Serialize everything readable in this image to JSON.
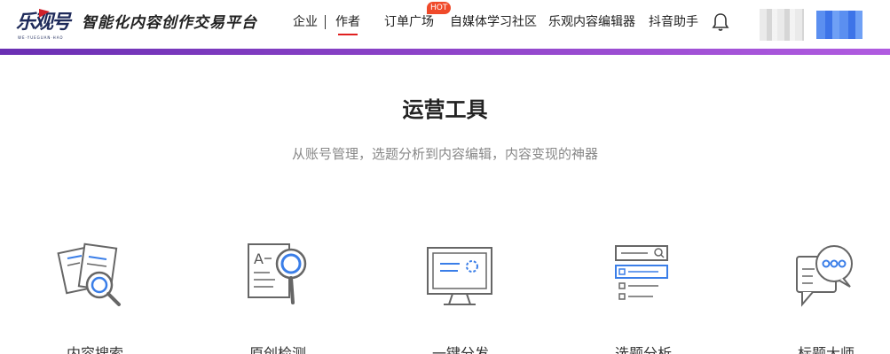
{
  "header": {
    "logo_text": "乐观号",
    "logo_sub": "WE·YUEGUAN·HAO",
    "slogan": "智能化内容创作交易平台",
    "nav": {
      "enterprise": "企业",
      "author": "作者",
      "orders": "订单广场",
      "orders_badge": "HOT",
      "community": "自媒体学习社区",
      "editor": "乐观内容编辑器",
      "douyin": "抖音助手"
    }
  },
  "section": {
    "title": "运营工具",
    "subtitle": "从账号管理，选题分析到内容编辑，内容变现的神器"
  },
  "tools": [
    {
      "icon": "documents-search-icon",
      "label": "内容搜索"
    },
    {
      "icon": "text-analysis-icon",
      "label": "原创检测"
    },
    {
      "icon": "monitor-loading-icon",
      "label": "一键分发"
    },
    {
      "icon": "search-list-icon",
      "label": "选题分析"
    },
    {
      "icon": "chat-bubbles-icon",
      "label": "标题大师"
    }
  ],
  "colors": {
    "accent_bar": "#8e44c9",
    "nav_active": "#e02020",
    "hot_badge": "#f04a2a",
    "icon_blue": "#3a7ee8",
    "icon_gray": "#666666"
  }
}
